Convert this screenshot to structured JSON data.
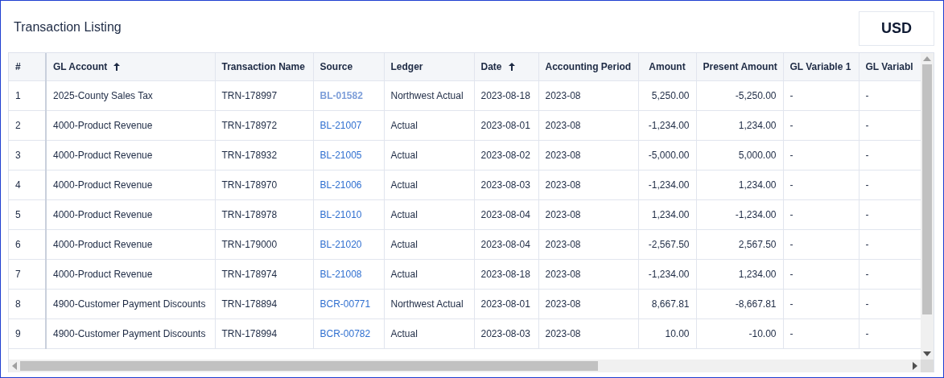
{
  "title": "Transaction Listing",
  "currency": "USD",
  "table": {
    "columns": [
      {
        "label": "#",
        "kind": "text",
        "sorted": false
      },
      {
        "label": "GL Account",
        "kind": "text",
        "sorted": true
      },
      {
        "label": "Transaction Name",
        "kind": "text",
        "sorted": false
      },
      {
        "label": "Source",
        "kind": "link",
        "sorted": false
      },
      {
        "label": "Ledger",
        "kind": "text",
        "sorted": false
      },
      {
        "label": "Date",
        "kind": "text",
        "sorted": true
      },
      {
        "label": "Accounting Period",
        "kind": "text",
        "sorted": false
      },
      {
        "label": "Amount",
        "kind": "number",
        "sorted": false
      },
      {
        "label": "Present Amount",
        "kind": "number",
        "sorted": false
      },
      {
        "label": "GL Variable 1",
        "kind": "text",
        "sorted": false
      },
      {
        "label": "GL Variabl",
        "kind": "text",
        "sorted": false
      }
    ],
    "rows": [
      {
        "cells": [
          "1",
          "2025-County Sales Tax",
          "TRN-178997",
          {
            "text": "BL-01582",
            "highlighted": true
          },
          "Northwest Actual",
          "2023-08-18",
          "2023-08",
          "5,250.00",
          "-5,250.00",
          "-",
          "-"
        ]
      },
      {
        "cells": [
          "2",
          "4000-Product Revenue",
          "TRN-178972",
          {
            "text": "BL-21007",
            "highlighted": false
          },
          "Actual",
          "2023-08-01",
          "2023-08",
          "-1,234.00",
          "1,234.00",
          "-",
          "-"
        ]
      },
      {
        "cells": [
          "3",
          "4000-Product Revenue",
          "TRN-178932",
          {
            "text": "BL-21005",
            "highlighted": false
          },
          "Actual",
          "2023-08-02",
          "2023-08",
          "-5,000.00",
          "5,000.00",
          "-",
          "-"
        ]
      },
      {
        "cells": [
          "4",
          "4000-Product Revenue",
          "TRN-178970",
          {
            "text": "BL-21006",
            "highlighted": false
          },
          "Actual",
          "2023-08-03",
          "2023-08",
          "-1,234.00",
          "1,234.00",
          "-",
          "-"
        ]
      },
      {
        "cells": [
          "5",
          "4000-Product Revenue",
          "TRN-178978",
          {
            "text": "BL-21010",
            "highlighted": false
          },
          "Actual",
          "2023-08-04",
          "2023-08",
          "1,234.00",
          "-1,234.00",
          "-",
          "-"
        ]
      },
      {
        "cells": [
          "6",
          "4000-Product Revenue",
          "TRN-179000",
          {
            "text": "BL-21020",
            "highlighted": false
          },
          "Actual",
          "2023-08-04",
          "2023-08",
          "-2,567.50",
          "2,567.50",
          "-",
          "-"
        ]
      },
      {
        "cells": [
          "7",
          "4000-Product Revenue",
          "TRN-178974",
          {
            "text": "BL-21008",
            "highlighted": false
          },
          "Actual",
          "2023-08-18",
          "2023-08",
          "-1,234.00",
          "1,234.00",
          "-",
          "-"
        ]
      },
      {
        "cells": [
          "8",
          "4900-Customer Payment Discounts",
          "TRN-178894",
          {
            "text": "BCR-00771",
            "highlighted": false
          },
          "Northwest Actual",
          "2023-08-01",
          "2023-08",
          "8,667.81",
          "-8,667.81",
          "-",
          "-"
        ]
      },
      {
        "cells": [
          "9",
          "4900-Customer Payment Discounts",
          "TRN-178994",
          {
            "text": "BCR-00782",
            "highlighted": false
          },
          "Actual",
          "2023-08-03",
          "2023-08",
          "10.00",
          "-10.00",
          "-",
          "-"
        ]
      }
    ]
  }
}
